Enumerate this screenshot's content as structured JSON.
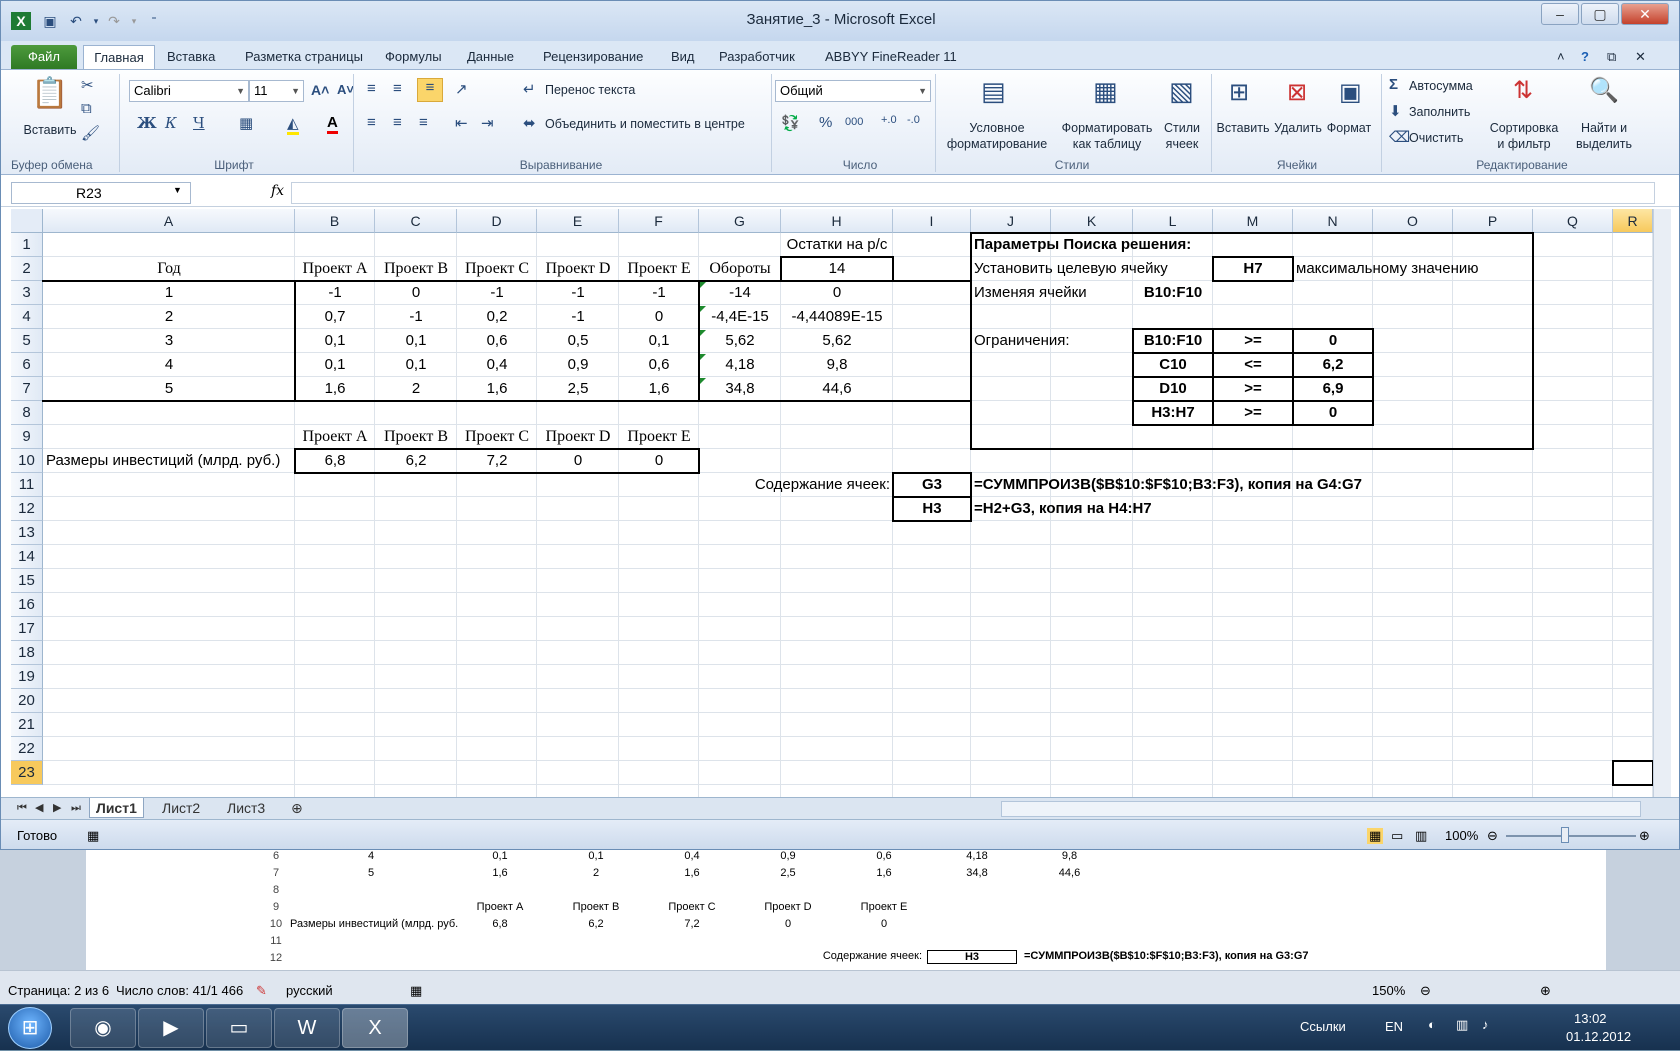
{
  "window": {
    "title": "Занятие_3 - Microsoft Excel"
  },
  "ribbon": {
    "tabs": [
      "Файл",
      "Главная",
      "Вставка",
      "Разметка страницы",
      "Формулы",
      "Данные",
      "Рецензирование",
      "Вид",
      "Разработчик",
      "ABBYY FineReader 11"
    ],
    "clipboard": {
      "paste": "Вставить",
      "label": "Буфер обмена"
    },
    "font": {
      "name": "Calibri",
      "size": "11",
      "label": "Шрифт",
      "bold": "Ж",
      "italic": "К",
      "underline": "Ч"
    },
    "alignment": {
      "wrap": "Перенос текста",
      "merge": "Объединить и поместить в центре",
      "label": "Выравнивание"
    },
    "number": {
      "format": "Общий",
      "label": "Число",
      "percent": "%",
      "thousands": "000"
    },
    "styles": {
      "conditional": [
        "Условное",
        "форматирование"
      ],
      "table": [
        "Форматировать",
        "как таблицу"
      ],
      "cell": [
        "Стили",
        "ячеек"
      ],
      "label": "Стили"
    },
    "cells": {
      "insert": "Вставить",
      "delete": "Удалить",
      "format": "Формат",
      "label": "Ячейки"
    },
    "editing": {
      "autosum": "Автосумма",
      "fill": "Заполнить",
      "clear": "Очистить",
      "sort": [
        "Сортировка",
        "и фильтр"
      ],
      "find": [
        "Найти и",
        "выделить"
      ],
      "label": "Редактирование"
    }
  },
  "formula_bar": {
    "name_box": "R23",
    "fx": "fx",
    "formula": ""
  },
  "columns": [
    "A",
    "B",
    "C",
    "D",
    "E",
    "F",
    "G",
    "H",
    "I",
    "J",
    "K",
    "L",
    "M",
    "N",
    "O",
    "P",
    "Q",
    "R"
  ],
  "rows": [
    "1",
    "2",
    "3",
    "4",
    "5",
    "6",
    "7",
    "8",
    "9",
    "10",
    "11",
    "12",
    "13",
    "14",
    "15",
    "16",
    "17",
    "18",
    "19",
    "20",
    "21",
    "22",
    "23"
  ],
  "sheet": {
    "h1": "Остатки на р/с",
    "header_year": "Год",
    "header_projects": [
      "Проект A",
      "Проект B",
      "Проект C",
      "Проект D",
      "Проект E"
    ],
    "header_turnover": "Обороты",
    "h2": "14",
    "data": [
      [
        "1",
        "-1",
        "0",
        "-1",
        "-1",
        "-1",
        "-14",
        "0"
      ],
      [
        "2",
        "0,7",
        "-1",
        "0,2",
        "-1",
        "0",
        "-4,4E-15",
        "-4,44089E-15"
      ],
      [
        "3",
        "0,1",
        "0,1",
        "0,6",
        "0,5",
        "0,1",
        "5,62",
        "5,62"
      ],
      [
        "4",
        "0,1",
        "0,1",
        "0,4",
        "0,9",
        "0,6",
        "4,18",
        "9,8"
      ],
      [
        "5",
        "1,6",
        "2",
        "1,6",
        "2,5",
        "1,6",
        "34,8",
        "44,6"
      ]
    ],
    "row9_projects": [
      "Проект A",
      "Проект B",
      "Проект C",
      "Проект D",
      "Проект E"
    ],
    "inv_label": "Размеры инвестиций (млрд. руб.)",
    "inv_values": [
      "6,8",
      "6,2",
      "7,2",
      "0",
      "0"
    ],
    "solver_title": "Параметры Поиска решения:",
    "solver_target_label": "Установить целевую ячейку",
    "solver_target": "H7",
    "solver_goal": "максимальному значению",
    "solver_changing_label": "Изменяя ячейки",
    "solver_changing": "B10:F10",
    "constraints_label": "Ограничения:",
    "constraints": [
      [
        "B10:F10",
        ">=",
        "0"
      ],
      [
        "C10",
        "<=",
        "6,2"
      ],
      [
        "D10",
        ">=",
        "6,9"
      ],
      [
        "H3:H7",
        ">=",
        "0"
      ]
    ],
    "contents_label": "Содержание ячеек:",
    "g3_ref": "G3",
    "g3_formula": "=СУММПРОИЗВ($B$10:$F$10;B3:F3), копия на G4:G7",
    "h3_ref": "H3",
    "h3_formula": "=H2+G3, копия на H4:H7"
  },
  "sheet_tabs": [
    "Лист1",
    "Лист2",
    "Лист3"
  ],
  "status": {
    "ready": "Готово",
    "zoom": "100%"
  },
  "word": {
    "rows": [
      {
        "n": "6",
        "cells": [
          "4",
          "0,1",
          "0,1",
          "0,4",
          "0,9",
          "0,6",
          "4,18",
          "9,8"
        ]
      },
      {
        "n": "7",
        "cells": [
          "5",
          "1,6",
          "2",
          "1,6",
          "2,5",
          "1,6",
          "34,8",
          "44,6"
        ]
      },
      {
        "n": "8",
        "cells": [
          "",
          "",
          "",
          "",
          "",
          "",
          "",
          ""
        ]
      },
      {
        "n": "9",
        "cells": [
          "",
          "Проект A",
          "Проект B",
          "Проект C",
          "Проект D",
          "Проект E",
          "",
          ""
        ]
      },
      {
        "n": "10",
        "cells": [
          "Размеры инвестиций (млрд. руб.",
          "6,8",
          "6,2",
          "7,2",
          "0",
          "0",
          "",
          ""
        ]
      },
      {
        "n": "11",
        "cells": [
          "",
          "",
          "",
          "",
          "",
          "",
          "",
          ""
        ]
      },
      {
        "n": "12",
        "cells": [
          "",
          "",
          "",
          "",
          "",
          "",
          "",
          ""
        ]
      }
    ],
    "row12_label": "Содержание ячеек:",
    "row12_ref": "H3",
    "row12_formula": "=СУММПРОИЗВ($B$10:$F$10;B3:F3), копия на G3:G7",
    "status_page": "Страница: 2 из 6",
    "status_words": "Число слов: 41/1 466",
    "status_lang": "русский",
    "zoom": "150%"
  },
  "taskbar": {
    "links": "Ссылки",
    "lang": "EN",
    "time": "13:02",
    "date": "01.12.2012"
  }
}
